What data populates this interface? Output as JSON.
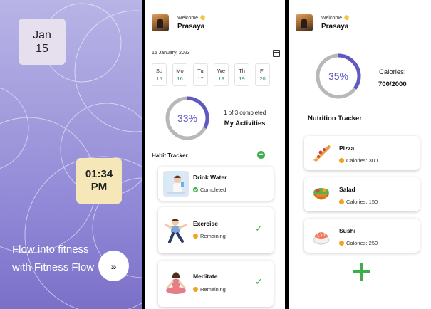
{
  "splash": {
    "date_month": "Jan",
    "date_day": "15",
    "time_top": "01:34",
    "time_bottom": "PM",
    "tagline": "Flow into fitness with Fitness Flow",
    "next_label": "»"
  },
  "activities_screen": {
    "welcome": "Welcome 👋",
    "user_name": "Prasaya",
    "date_label": "15 January, 2023",
    "days": [
      {
        "name": "Su",
        "num": "15"
      },
      {
        "name": "Mo",
        "num": "16"
      },
      {
        "name": "Tu",
        "num": "17"
      },
      {
        "name": "We",
        "num": "18"
      },
      {
        "name": "Th",
        "num": "19"
      },
      {
        "name": "Fr",
        "num": "20"
      }
    ],
    "progress": 0.33,
    "progress_label": "33%",
    "completed_text": "1 of 3 completed",
    "activities_title": "My Activities",
    "habit_title": "Habit Tracker",
    "add_label": "+",
    "habits": [
      {
        "name": "Drink Water",
        "status": "Completed"
      },
      {
        "name": "Exercise",
        "status": "Remaining",
        "check": "✓"
      },
      {
        "name": "Meditate",
        "status": "Remaining",
        "check": "✓"
      }
    ]
  },
  "nutrition_screen": {
    "welcome": "Welcome 👋",
    "user_name": "Prasaya",
    "progress": 0.35,
    "progress_label": "35%",
    "calories_label": "Calories:",
    "calories_value": "700/2000",
    "section_title": "Nutrition Tracker",
    "foods": [
      {
        "name": "Pizza",
        "calories": "Calories: 300"
      },
      {
        "name": "Salad",
        "calories": "Calories: 150"
      },
      {
        "name": "Sushi",
        "calories": "Calories: 250"
      }
    ]
  },
  "colors": {
    "accent": "#5f5ac2",
    "ring_track": "#b8b8b8",
    "success": "#3cae4c",
    "warning": "#f2a31f"
  }
}
